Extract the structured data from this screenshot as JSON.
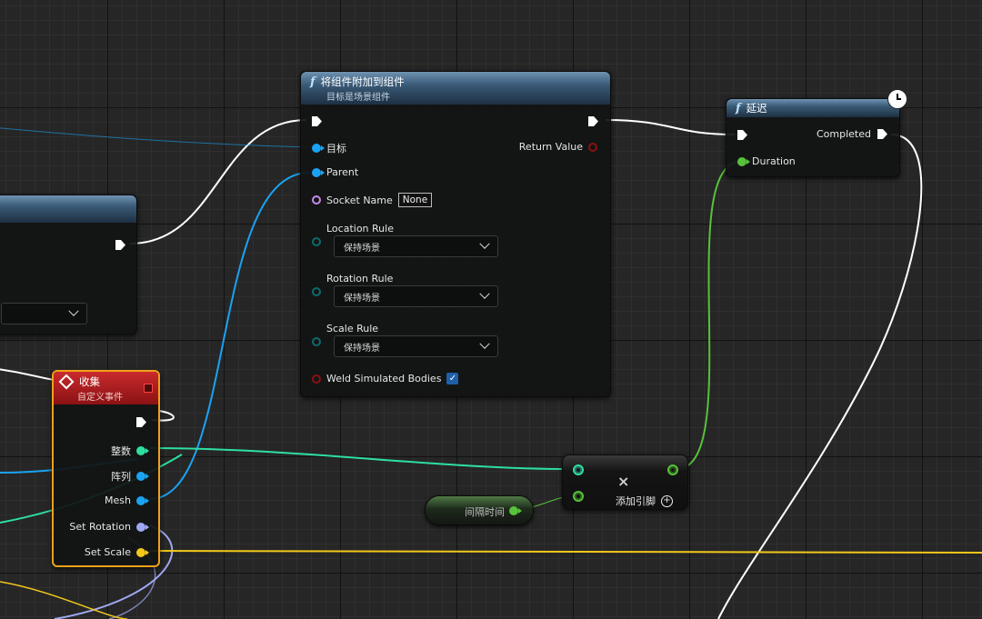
{
  "attach_node": {
    "title": "将组件附加到组件",
    "subtitle": "目标是场景组件",
    "fn_glyph": "f",
    "pins": {
      "target": "目标",
      "parent": "Parent",
      "socket_name": "Socket Name",
      "socket_value": "None",
      "return_value": "Return Value",
      "location_rule": "Location Rule",
      "location_value": "保持场景",
      "rotation_rule": "Rotation Rule",
      "rotation_value": "保持场景",
      "scale_rule": "Scale Rule",
      "scale_value": "保持场景",
      "weld": "Weld Simulated Bodies",
      "weld_checked": true
    }
  },
  "delay_node": {
    "title": "延迟",
    "fn_glyph": "f",
    "completed": "Completed",
    "duration": "Duration"
  },
  "event_node": {
    "title": "收集",
    "subtitle": "自定义事件",
    "outputs": [
      "整数",
      "阵列",
      "Mesh",
      "Set Rotation",
      "Set Scale"
    ]
  },
  "add_node": {
    "symbol": "×",
    "add_pin": "添加引脚"
  },
  "var_node": {
    "label": "间隔时间"
  },
  "colors": {
    "exec": "#ffffff",
    "object": "#1aa3f2",
    "name": "#c58af0",
    "enum": "#0c6b6b",
    "float": "#57c23a",
    "int": "#2de0a0",
    "rotator": "#9fa8f2",
    "vector": "#f2c81a",
    "event_header": "#b4191b"
  }
}
